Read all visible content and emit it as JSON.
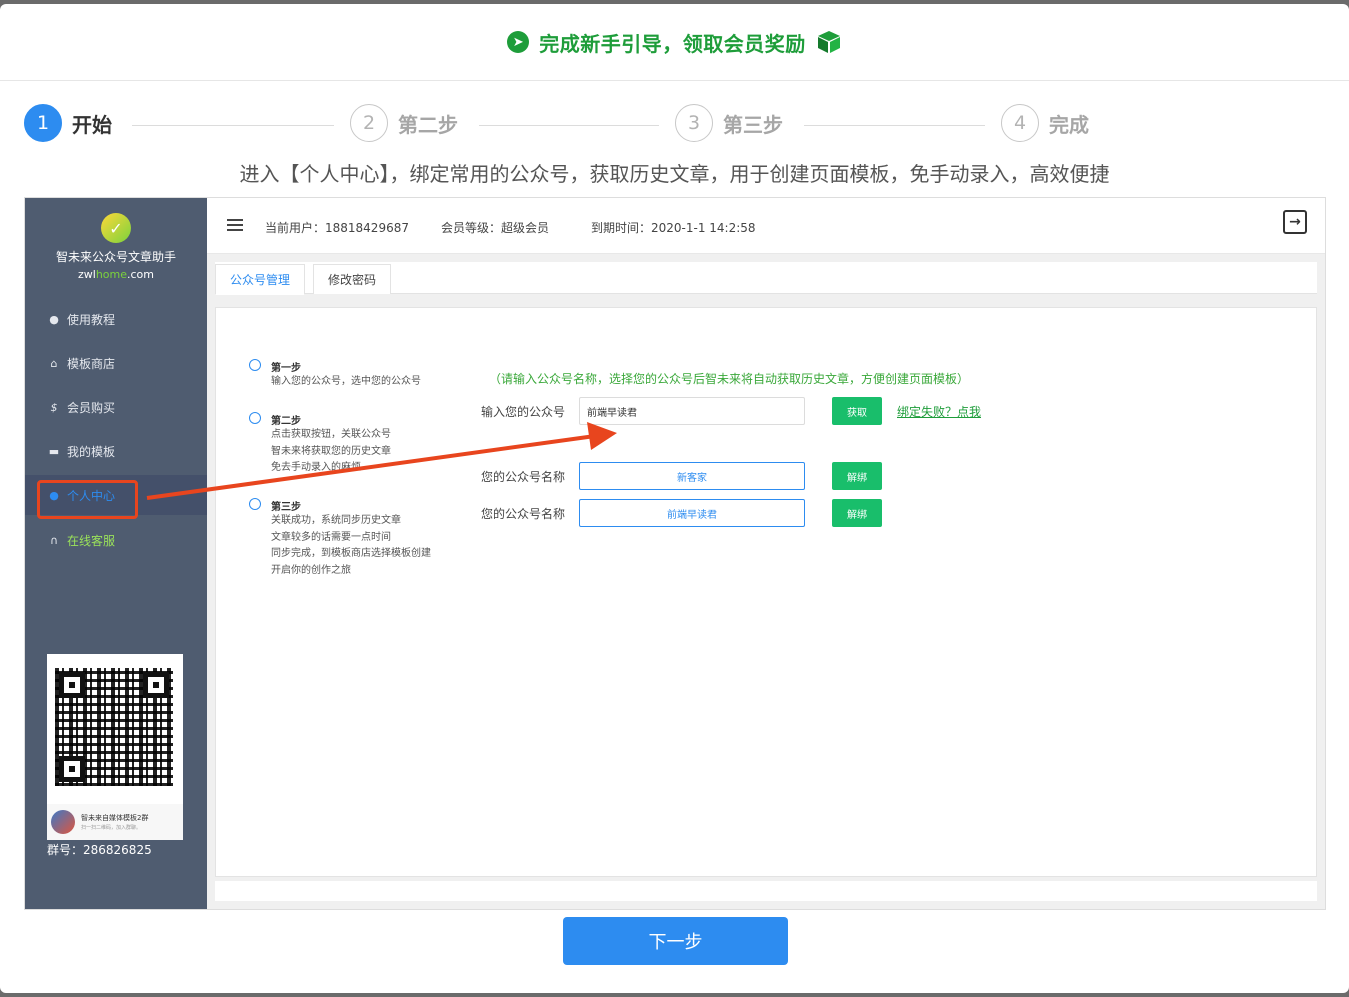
{
  "header": {
    "title": "完成新手引导，领取会员奖励"
  },
  "steps": [
    {
      "num": "1",
      "label": "开始"
    },
    {
      "num": "2",
      "label": "第二步"
    },
    {
      "num": "3",
      "label": "第三步"
    },
    {
      "num": "4",
      "label": "完成"
    }
  ],
  "description": "进入【个人中心】，绑定常用的公众号，获取历史文章，用于创建页面模板，免手动录入，高效便捷",
  "app": {
    "brand": "智未来公众号文章助手",
    "domain_a": "zwl",
    "domain_b": "home",
    "domain_c": ".com",
    "nav": [
      {
        "icon": "question-icon",
        "label": "使用教程"
      },
      {
        "icon": "home-icon",
        "label": "模板商店"
      },
      {
        "icon": "dollar-icon",
        "label": "会员购买"
      },
      {
        "icon": "template-icon",
        "label": "我的模板"
      },
      {
        "icon": "user-icon",
        "label": "个人中心"
      },
      {
        "icon": "headset-icon",
        "label": "在线客服"
      }
    ],
    "qr": {
      "name": "智未来自媒体模板2群",
      "sub": "扫一扫二维码，加入群聊。"
    },
    "group": "群号：286826825",
    "topbar": {
      "user": "当前用户：18818429687",
      "level": "会员等级：超级会员",
      "expire": "到期时间：2020-1-1 14:2:58"
    },
    "tabs": [
      "公众号管理",
      "修改密码"
    ],
    "timeline": [
      {
        "title": "第一步",
        "lines": [
          "输入您的公众号，选中您的公众号"
        ]
      },
      {
        "title": "第二步",
        "lines": [
          "点击获取按钮，关联公众号",
          "智未来将获取您的历史文章",
          "免去手动录入的麻烦"
        ]
      },
      {
        "title": "第三步",
        "lines": [
          "关联成功，系统同步历史文章",
          "文章较多的话需要一点时间",
          "同步完成，到模板商店选择模板创建",
          "开启你的创作之旅"
        ]
      }
    ],
    "hint": "（请输入公众号名称，选择您的公众号后智未来将自动获取历史文章，方便创建页面模板）",
    "input_label": "输入您的公众号",
    "input_value": "前端早读君",
    "fetch_btn": "获取",
    "fail_link": "绑定失败？点我",
    "accounts": [
      {
        "label": "您的公众号名称",
        "name": "新客家",
        "btn": "解绑"
      },
      {
        "label": "您的公众号名称",
        "name": "前端早读君",
        "btn": "解绑"
      }
    ]
  },
  "next_button": "下一步"
}
